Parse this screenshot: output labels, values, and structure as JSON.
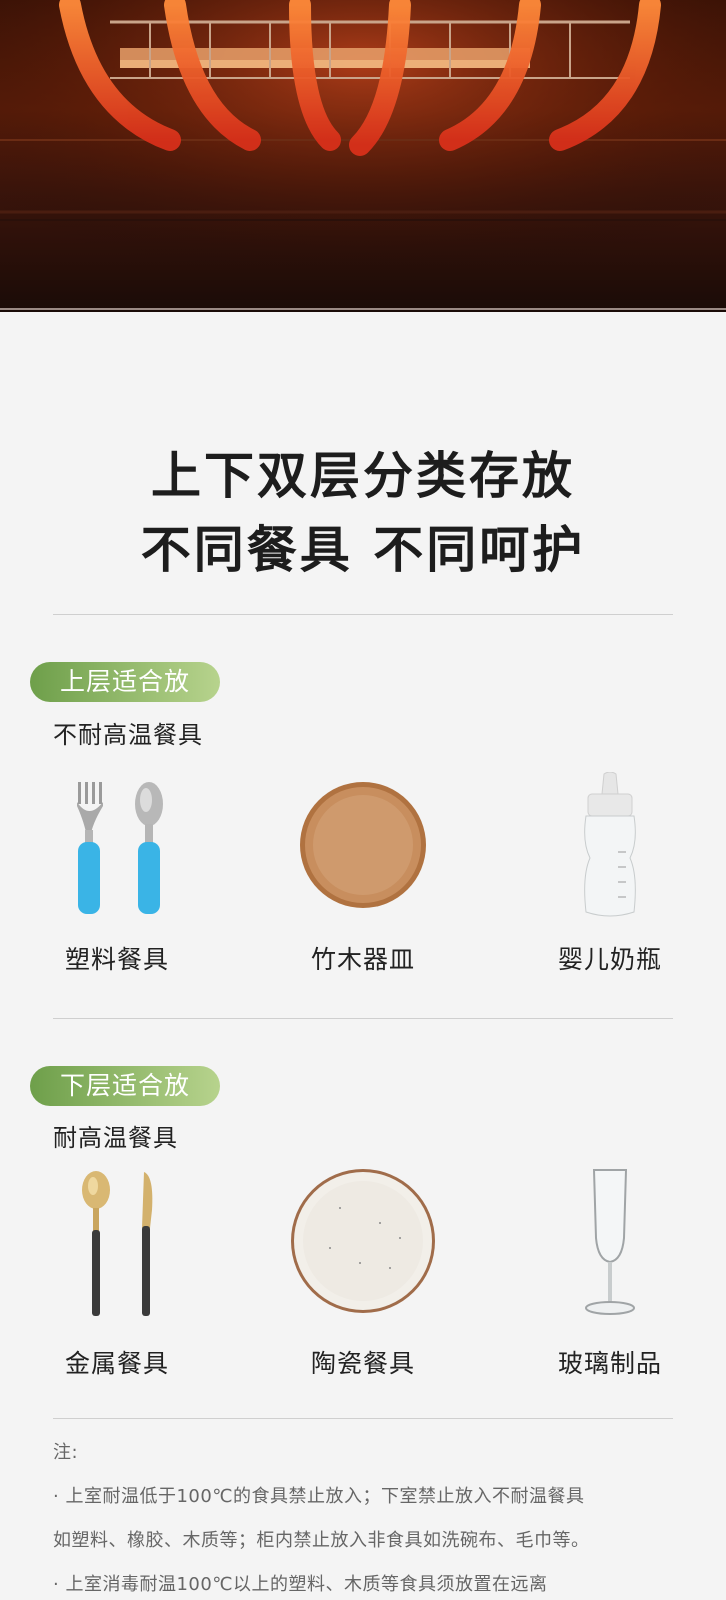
{
  "hero": {
    "icon": "heating-arrows-image",
    "colors": {
      "accent": "#ff4a12",
      "dark": "#3b1206"
    }
  },
  "headline": {
    "line1": "上下双层分类存放",
    "line2": "不同餐具  不同呵护"
  },
  "upper": {
    "badge": "上层适合放",
    "subtitle": "不耐高温餐具",
    "items": [
      {
        "icon": "fork-spoon-icon",
        "label": "塑料餐具"
      },
      {
        "icon": "wooden-plate-icon",
        "label": "竹木器皿"
      },
      {
        "icon": "baby-bottle-icon",
        "label": "婴儿奶瓶"
      }
    ]
  },
  "lower": {
    "badge": "下层适合放",
    "subtitle": "耐高温餐具",
    "items": [
      {
        "icon": "spoon-knife-icon",
        "label": "金属餐具"
      },
      {
        "icon": "ceramic-plate-icon",
        "label": "陶瓷餐具"
      },
      {
        "icon": "wine-glass-icon",
        "label": "玻璃制品"
      }
    ]
  },
  "notes": {
    "heading": "注:",
    "line1": "· 上室耐温低于100℃的食具禁止放入；下室禁止放入不耐温餐具",
    "line2": "如塑料、橡胶、木质等；柜内禁止放入非食具如洗碗布、毛巾等。",
    "line3": "· 上室消毒耐温100℃以上的塑料、木质等食具须放置在远离"
  },
  "colors": {
    "badge_start": "#6e9f4a",
    "badge_end": "#b7d38d",
    "background": "#f4f4f4"
  }
}
